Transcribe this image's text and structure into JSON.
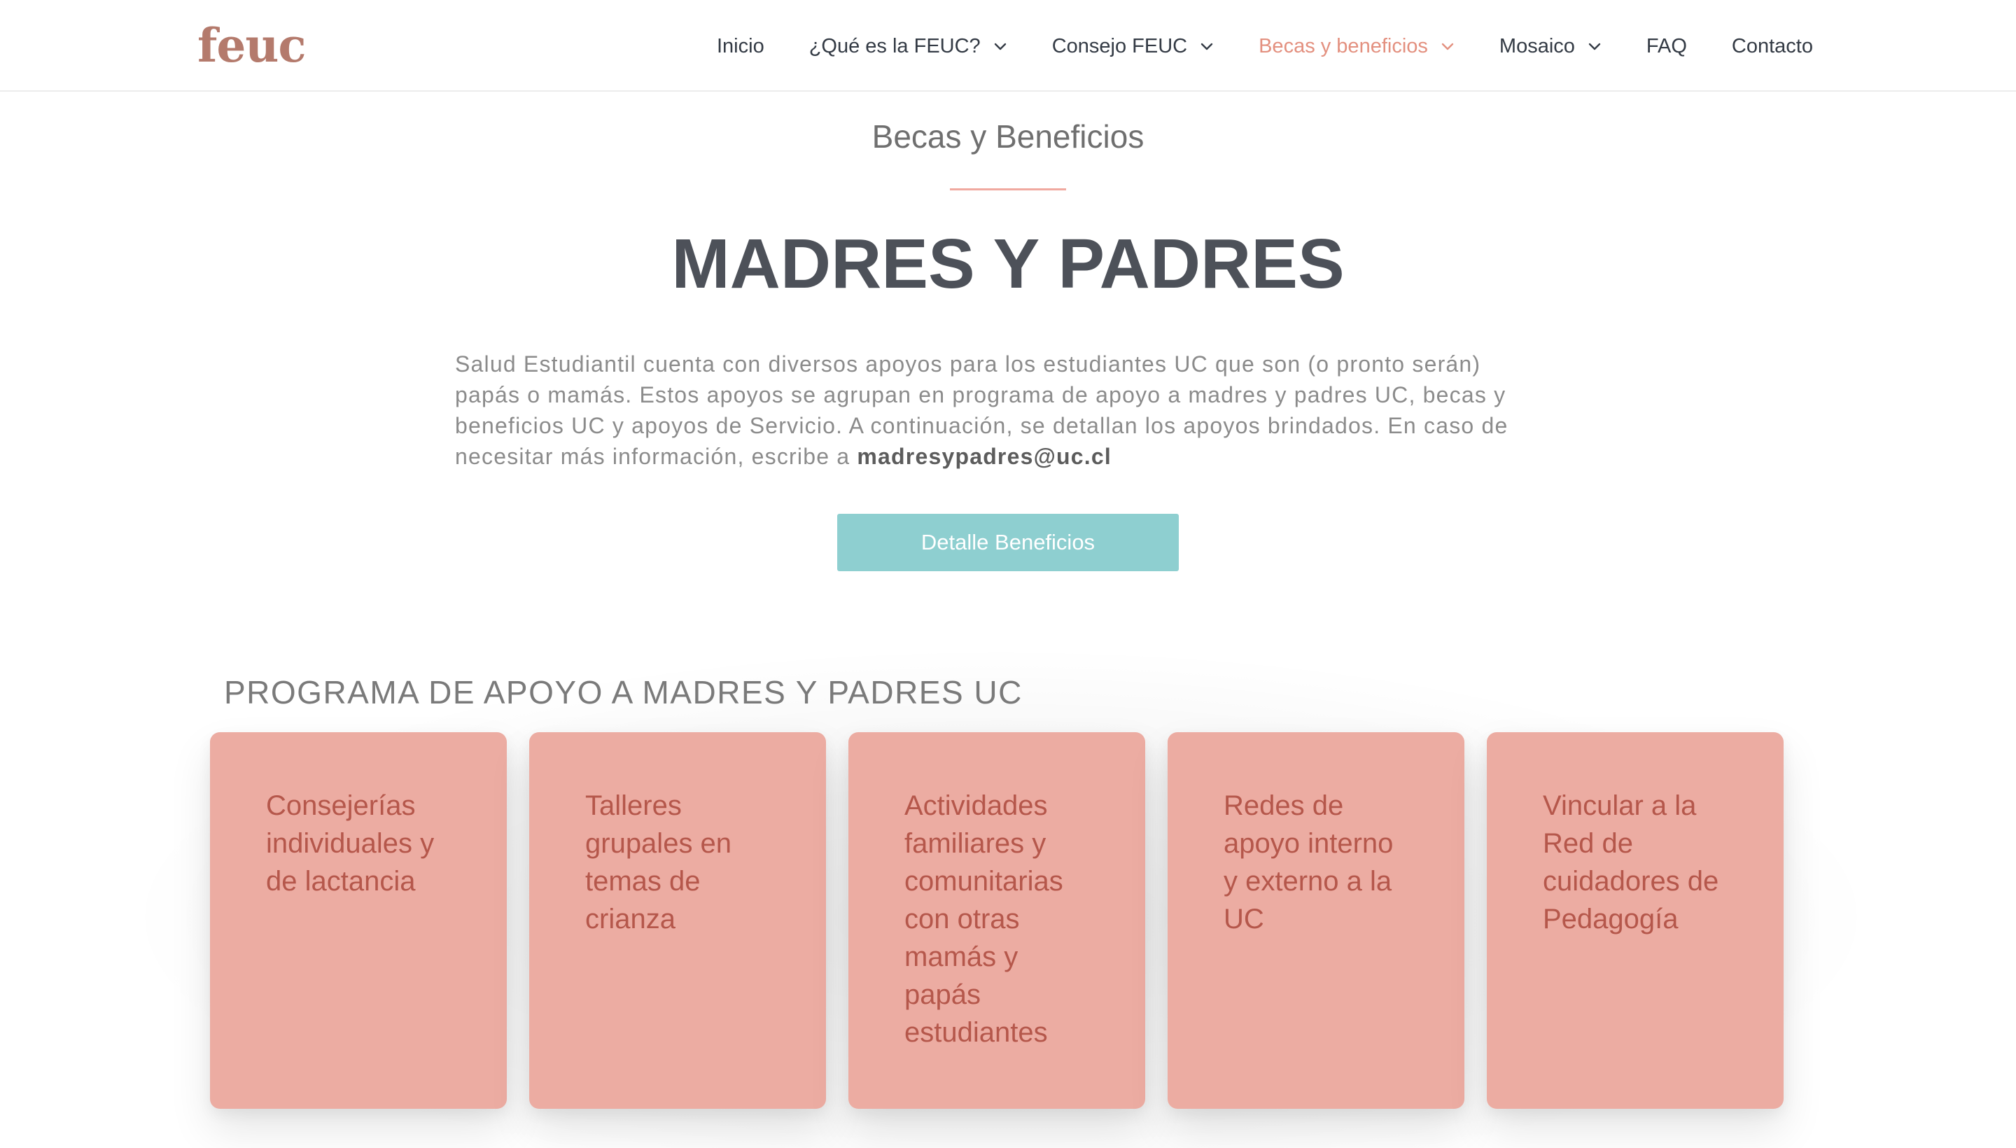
{
  "header": {
    "logo": "feuc",
    "nav": [
      {
        "label": "Inicio",
        "has_dropdown": false,
        "active": false
      },
      {
        "label": "¿Qué es la FEUC?",
        "has_dropdown": true,
        "active": false
      },
      {
        "label": "Consejo FEUC",
        "has_dropdown": true,
        "active": false
      },
      {
        "label": "Becas y beneficios",
        "has_dropdown": true,
        "active": true
      },
      {
        "label": "Mosaico",
        "has_dropdown": true,
        "active": false
      },
      {
        "label": "FAQ",
        "has_dropdown": false,
        "active": false
      },
      {
        "label": "Contacto",
        "has_dropdown": false,
        "active": false
      }
    ]
  },
  "hero": {
    "subtitle": "Becas y Beneficios",
    "title": "MADRES Y PADRES",
    "intro_lines": [
      "Salud Estudiantil cuenta con diversos apoyos para los estudiantes UC que son (o pronto serán)",
      "papás o mamás. Estos apoyos se agrupan en programa de apoyo a madres y padres UC, becas y",
      "beneficios UC y apoyos de Servicio. A continuación, se detallan los apoyos brindados. En caso de",
      "necesitar más información, escribe a "
    ],
    "email": "madresypadres@uc.cl",
    "cta_label": "Detalle Beneficios"
  },
  "program": {
    "title": "PROGRAMA DE APOYO A MADRES Y PADRES UC",
    "cards": [
      {
        "lines": [
          "Consejerías",
          "individuales y",
          "de lactancia"
        ]
      },
      {
        "lines": [
          "Talleres",
          "grupales en",
          "temas de",
          "crianza"
        ]
      },
      {
        "lines": [
          "Actividades",
          "familiares y",
          "comunitarias",
          "con otras",
          "mamás y",
          "papás",
          "estudiantes"
        ]
      },
      {
        "lines": [
          "Redes de",
          "apoyo interno",
          "y externo a la",
          "UC"
        ]
      },
      {
        "lines": [
          "Vincular a la",
          "Red de",
          "cuidadores de",
          "Pedagogía"
        ]
      }
    ]
  },
  "colors": {
    "logo": "#b47a6c",
    "nav_text": "#333a44",
    "nav_active": "#e3907f",
    "title": "#4d5159",
    "divider": "#f0a9a0",
    "cta_bg": "#8ecfd0",
    "card_bg": "#ecaca2",
    "card_text": "#b5574b"
  },
  "icons": {
    "dropdown": "chevron-down-icon"
  }
}
